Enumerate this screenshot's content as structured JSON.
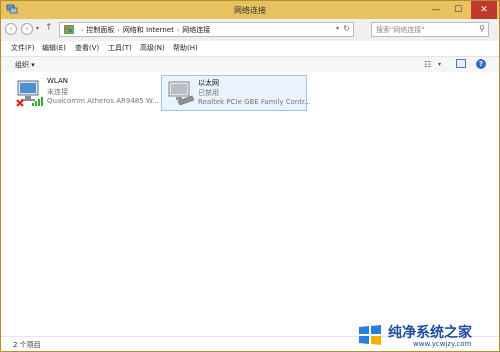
{
  "window": {
    "title": "网络连接",
    "minimize": "—",
    "maximize": "☐",
    "close": "✕"
  },
  "address": {
    "crumbs": [
      "控制面板",
      "网络和 Internet",
      "网络连接"
    ],
    "separator": "›",
    "dropdown": "▾",
    "refresh": "↻",
    "search_placeholder": "搜索\"网络连接\"",
    "search_icon": "⚲"
  },
  "nav": {
    "back": "‹",
    "forward": "›",
    "history": "▾",
    "up": "↑"
  },
  "menu": [
    "文件(F)",
    "编辑(E)",
    "查看(V)",
    "工具(T)",
    "高级(N)",
    "帮助(H)"
  ],
  "toolbar": {
    "organize": "组织 ▾",
    "views": "☷",
    "views_drop": "▾",
    "help": "?"
  },
  "connections": [
    {
      "name": "WLAN",
      "status": "未连接",
      "device": "Qualcomm Atheros AR9485 W..."
    },
    {
      "name": "以太网",
      "status": "已禁用",
      "device": "Realtek PCIe GBE Family Contr..."
    }
  ],
  "status": {
    "item_count": "2 个项目"
  },
  "watermark": {
    "text": "纯净系统之家",
    "url": "www.ycwjzy.com"
  },
  "colors": {
    "title_bar": "#e7c25f",
    "selection": "#e9f3fd",
    "watermark": "#1a4fa0"
  }
}
